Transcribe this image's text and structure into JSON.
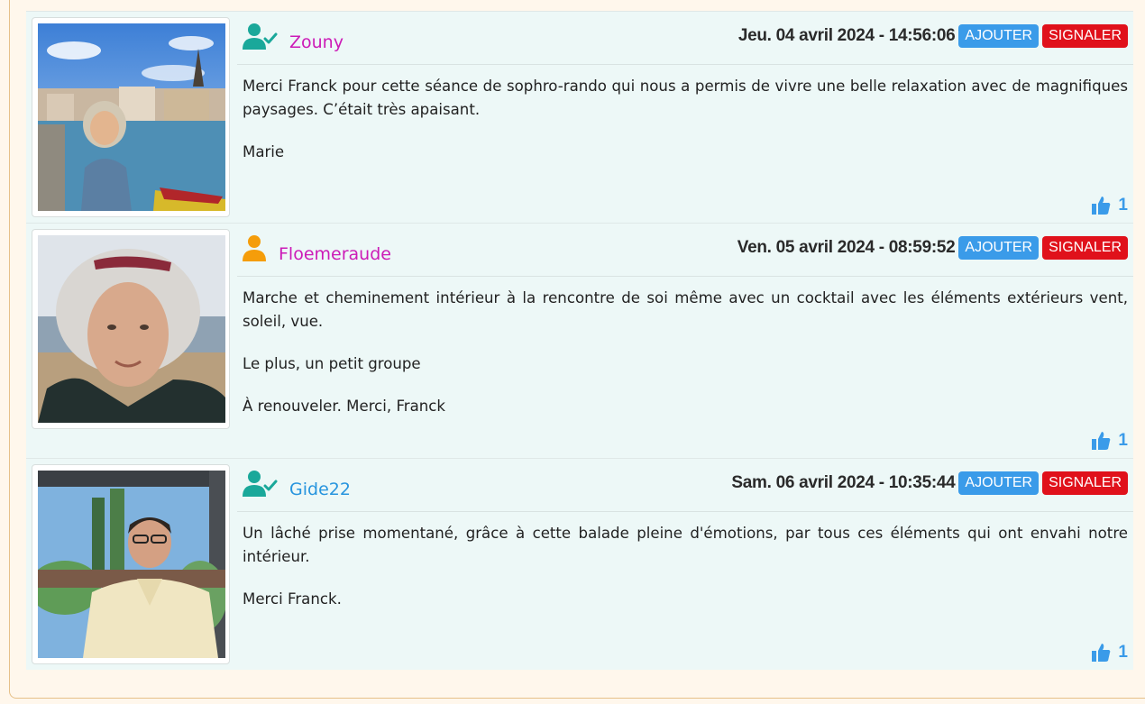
{
  "colors": {
    "username_magenta": "#cc1bb7",
    "username_blue": "#2895de",
    "icon_teal": "#1aa89a",
    "icon_orange": "#f59d0a",
    "add_button": "#3a9be9",
    "report_button": "#e0111b",
    "like_blue": "#3a9be9"
  },
  "comments": [
    {
      "username": "Zouny",
      "user_icon": "user-check-icon",
      "date": "Jeu. 04 avril 2024 - 14:56:06",
      "add_label": "AJOUTER",
      "report_label": "SIGNALER",
      "paragraphs": [
        "Merci Franck pour cette séance de sophro-rando qui nous a permis de vivre une belle relaxation avec de magnifiques paysages. C’était très apaisant.",
        "Marie"
      ],
      "likes": "1"
    },
    {
      "username": "Floemeraude",
      "user_icon": "user-icon",
      "date": "Ven. 05 avril 2024 - 08:59:52",
      "add_label": "AJOUTER",
      "report_label": "SIGNALER",
      "paragraphs": [
        "Marche et cheminement intérieur à la rencontre de soi même avec un cocktail avec les éléments extérieurs vent, soleil, vue.",
        "Le plus, un petit groupe",
        "À renouveler. Merci, Franck"
      ],
      "likes": "1"
    },
    {
      "username": "Gide22",
      "user_icon": "user-check-icon",
      "date": "Sam. 06 avril 2024 - 10:35:44",
      "add_label": "AJOUTER",
      "report_label": "SIGNALER",
      "paragraphs": [
        "Un lâché prise momentané, grâce à cette balade pleine d'émotions, par tous ces éléments qui ont envahi notre intérieur.",
        "Merci Franck."
      ],
      "likes": "1"
    }
  ]
}
